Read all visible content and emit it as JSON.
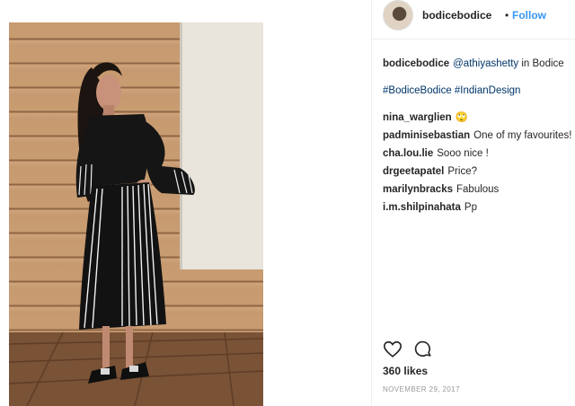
{
  "header": {
    "username": "bodicebodice",
    "separator": "•",
    "follow_label": "Follow"
  },
  "caption": {
    "username": "bodicebodice",
    "mention": "@athiyashetty",
    "text": " in Bodice",
    "hashtags": "#BodiceBodice #IndianDesign"
  },
  "comments": [
    {
      "username": "nina_warglien",
      "text": "🙄"
    },
    {
      "username": "padminisebastian",
      "text": "One of my favourites!"
    },
    {
      "username": "cha.lou.lie",
      "text": "Sooo nice !"
    },
    {
      "username": "drgeetapatel",
      "text": "Price?"
    },
    {
      "username": "marilynbracks",
      "text": "Fabulous"
    },
    {
      "username": "i.m.shilpinahata",
      "text": "Pp"
    }
  ],
  "actions": {
    "like_icon": "heart-outline-icon",
    "comment_icon": "comment-bubble-icon"
  },
  "likes": "360 likes",
  "date": "NOVEMBER 29, 2017"
}
